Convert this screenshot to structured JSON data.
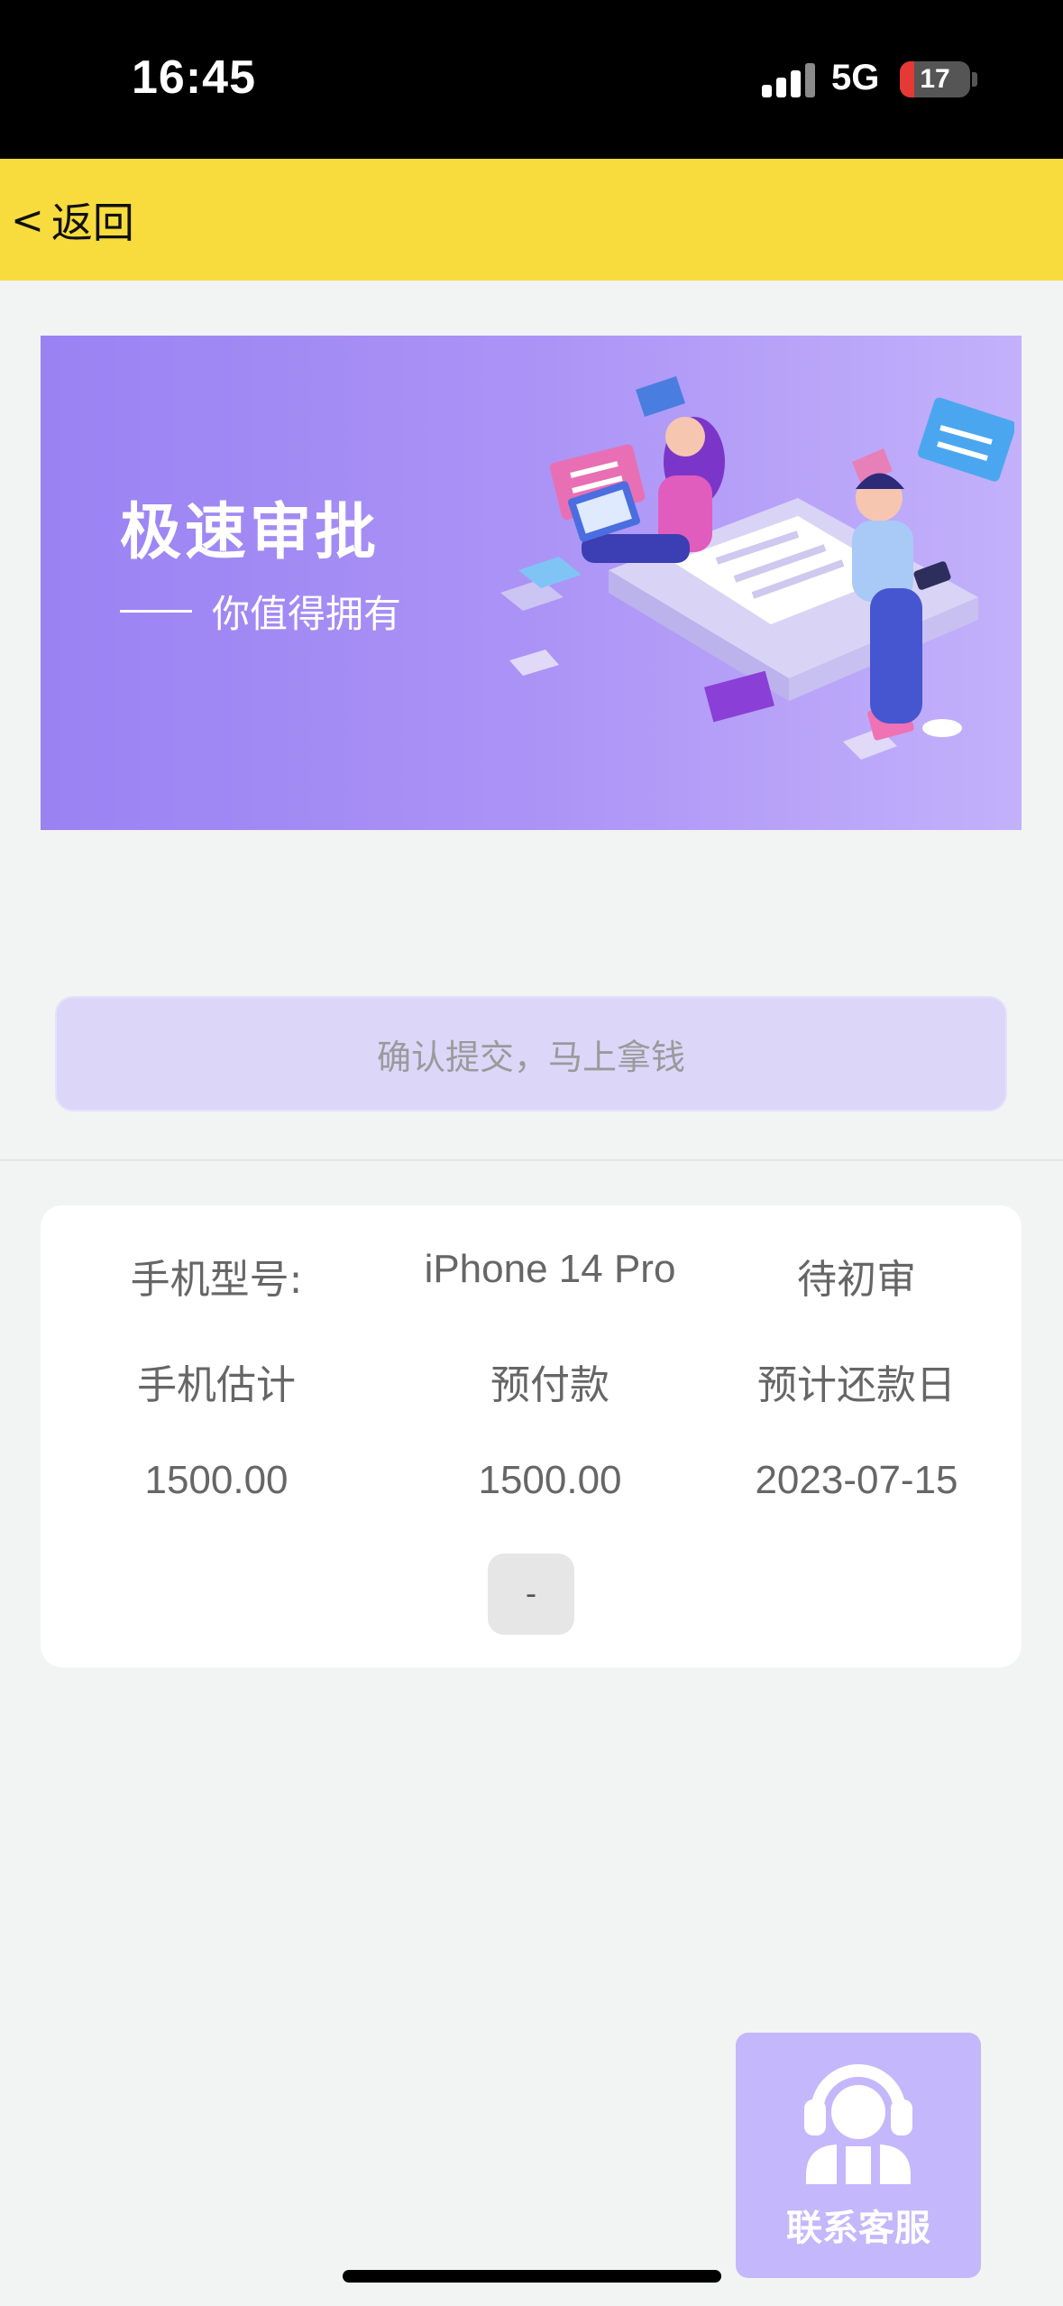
{
  "status_bar": {
    "time": "16:45",
    "network": "5G",
    "battery_level": "17",
    "signal_bars_active": 3,
    "signal_bars_total": 4
  },
  "nav": {
    "back_chevron": "<",
    "back_label": "返回"
  },
  "banner": {
    "title": "极速审批",
    "subtitle": "你值得拥有",
    "background_colors": [
      "#9a82f3",
      "#c3b1fb"
    ]
  },
  "submit_button": {
    "label": "确认提交，马上拿钱"
  },
  "info_card": {
    "model_label": "手机型号:",
    "model_value": "iPhone 14 Pro",
    "status": "待初审",
    "headers": [
      "手机估计",
      "预付款",
      "预计还款日"
    ],
    "values": [
      "1500.00",
      "1500.00",
      "2023-07-15"
    ],
    "detail_button": "-"
  },
  "service": {
    "label": "联系客服",
    "icon": "headset-icon"
  },
  "colors": {
    "nav_bg": "#f8dc3d",
    "page_bg": "#f2f3f3",
    "accent_purple": "#c5b7fb",
    "submit_bg": "#dcd6f9"
  }
}
